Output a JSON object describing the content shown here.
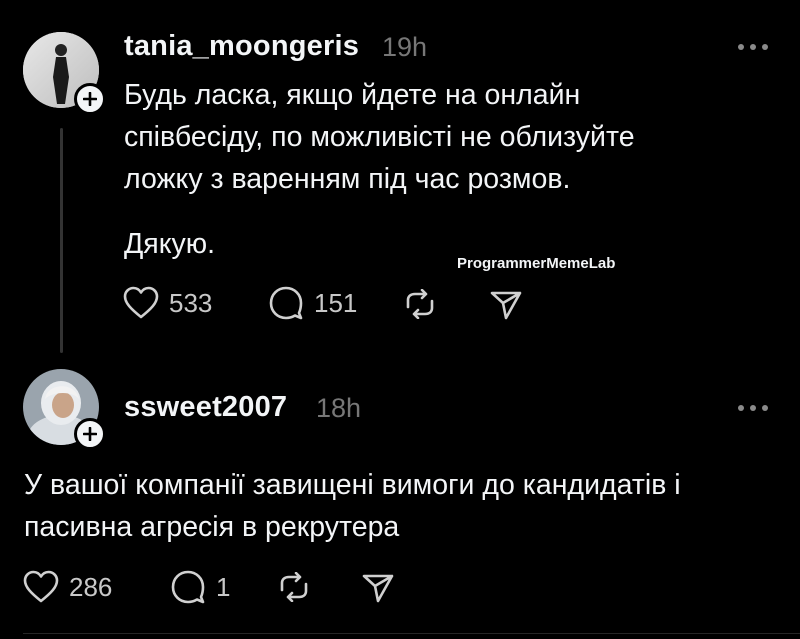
{
  "posts": [
    {
      "username": "tania_moongeris",
      "time": "19h",
      "paragraphs": [
        "Будь ласка, якщо йдете на онлайн",
        "співбесіду, по можливісті не облизуйте",
        "ложку з варенням під час розмов.",
        "Дякую."
      ],
      "likes": "533",
      "comments": "151"
    },
    {
      "username": "ssweet2007",
      "time": "18h",
      "paragraphs": [
        "У вашої компанії завищені вимоги до кандидатів і",
        "пасивна агресія в рекрутера"
      ],
      "likes": "286",
      "comments": "1"
    }
  ],
  "watermark": "ProgrammerMemeLab",
  "icons": {
    "like": "heart-icon",
    "comment": "comment-bubble-icon",
    "repost": "repost-icon",
    "share": "send-icon",
    "more": "more-dots-icon",
    "follow": "plus-icon"
  }
}
